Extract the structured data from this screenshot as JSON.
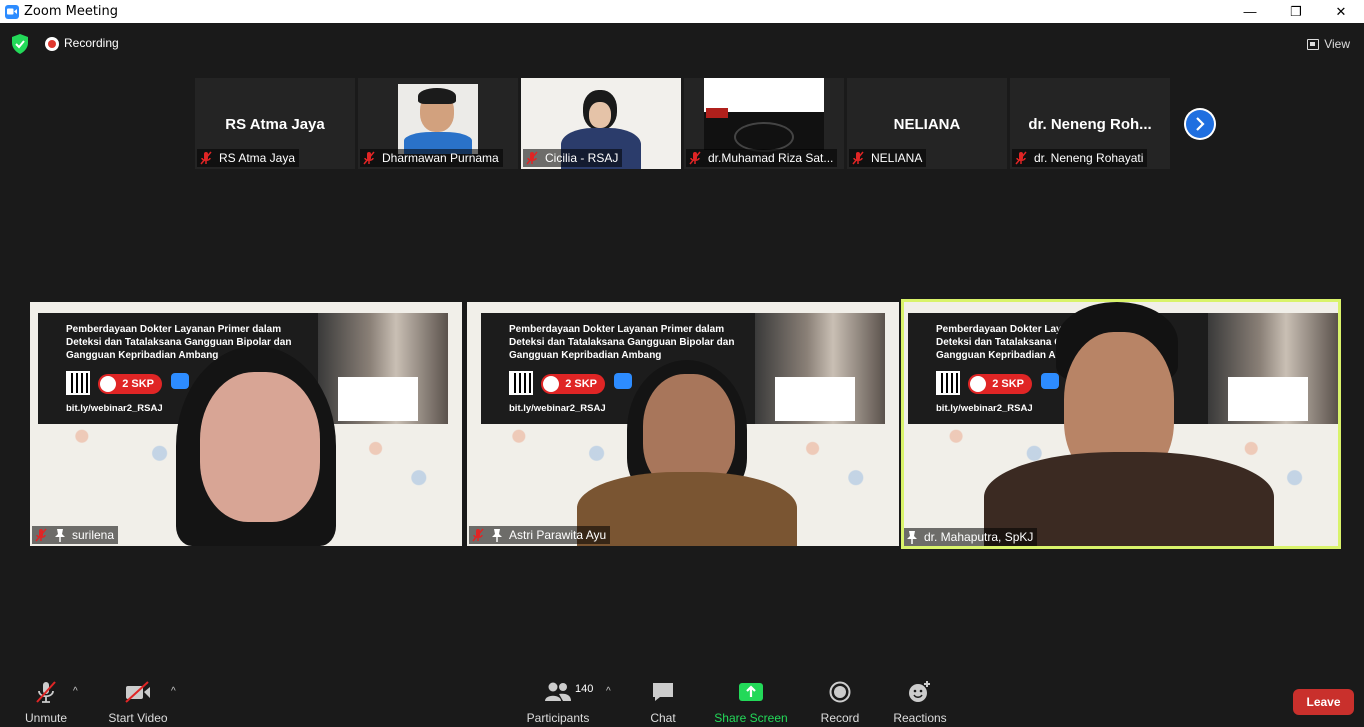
{
  "window": {
    "title": "Zoom Meeting",
    "minimize": "—",
    "maximize": "❐",
    "close": "✕"
  },
  "topbar": {
    "recording_label": "Recording",
    "view_label": "View"
  },
  "thumbnails": [
    {
      "display_name": "RS Atma Jaya",
      "label": "RS Atma Jaya",
      "video": false
    },
    {
      "display_name": "",
      "label": "Dharmawan Purnama",
      "video": true
    },
    {
      "display_name": "",
      "label": "Cicilia - RSAJ",
      "video": true
    },
    {
      "display_name": "",
      "label": "dr.Muhamad Riza Sat...",
      "video": true
    },
    {
      "display_name": "NELIANA",
      "label": "NELIANA",
      "video": false
    },
    {
      "display_name": "dr. Neneng Roh...",
      "label": "dr. Neneng Rohayati",
      "video": false
    }
  ],
  "banner": {
    "title": "Pemberdayaan Dokter Layanan Primer dalam Deteksi dan Tatalaksana Gangguan Bipolar dan Gangguan Kepribadian Ambang",
    "title_cropped": "Pemberdayaan Dokter La... Deteksi dan Tatalaksana... Gangguan Kepribadian...",
    "skp": "2 SKP",
    "link": "bit.ly/webinar2_RSAJ"
  },
  "main_tiles": [
    {
      "label": "surilena",
      "muted": true,
      "active": false
    },
    {
      "label": "Astri Parawita Ayu",
      "muted": true,
      "active": false
    },
    {
      "label": "dr. Mahaputra, SpKJ",
      "muted": false,
      "active": true
    }
  ],
  "toolbar": {
    "unmute": "Unmute",
    "start_video": "Start Video",
    "participants": "Participants",
    "participants_count": "140",
    "chat": "Chat",
    "share_screen": "Share Screen",
    "record": "Record",
    "reactions": "Reactions",
    "leave": "Leave"
  },
  "colors": {
    "background": "#1a1a1a",
    "share_green": "#23d959",
    "leave_red": "#c9302c",
    "active_border": "#d9f36b",
    "accent_blue": "#1f6fe0"
  }
}
